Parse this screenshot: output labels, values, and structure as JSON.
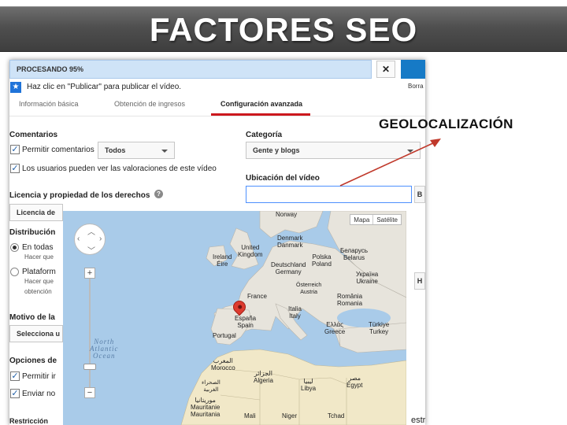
{
  "slide": {
    "title": "FACTORES SEO"
  },
  "annotation": {
    "label": "GEOLOCALIZACIÓN",
    "arrow_color": "#c0392b"
  },
  "upload": {
    "progress_label": "PROCESANDO 95%",
    "progress_value": 0.95,
    "close_label": "✕",
    "info_text": "Haz clic en \"Publicar\" para publicar el vídeo.",
    "info_icon": "star-icon",
    "draft_text": "Borra"
  },
  "tabs": [
    {
      "label": "Información básica",
      "active": false
    },
    {
      "label": "Obtención de ingresos",
      "active": false
    },
    {
      "label": "Configuración avanzada",
      "active": true
    }
  ],
  "left": {
    "comments_heading": "Comentarios",
    "allow_comments": "Permitir comentarios",
    "comments_select": "Todos",
    "ratings_label": "Los usuarios pueden ver las valoraciones de este vídeo",
    "license_heading": "Licencia y propiedad de los derechos",
    "license_select": "Licencia de",
    "distribution_heading": "Distribución",
    "dist_opt1": "En todas",
    "dist_opt1_sub": "Hacer que",
    "dist_opt2": "Plataform",
    "dist_opt2_sub1": "Hacer que",
    "dist_opt2_sub2": "obtención",
    "reason_heading": "Motivo de la",
    "reason_select": "Selecciona u",
    "options_heading": "Opciones de",
    "opt_allow": "Permitir ir",
    "opt_send": "Enviar no",
    "bottom_frag": "Restricción"
  },
  "right": {
    "category_heading": "Categoría",
    "category_select": "Gente y blogs",
    "location_heading": "Ubicación del vídeo",
    "location_value": "",
    "side_btn_b": "B",
    "side_btn_h": "H",
    "frag_right": "estr"
  },
  "map": {
    "type_map": "Mapa",
    "type_sat": "Satélite",
    "zoom_in": "+",
    "zoom_out": "−",
    "labels": {
      "norway": "Norway",
      "denmark": "Denmark\nDanmark",
      "uk": "United\nKingdom",
      "ireland": "Ireland\nÉire",
      "belarus": "Беларусь\nBelarus",
      "poland": "Polska\nPoland",
      "germany": "Deutschland\nGermany",
      "ukraine": "Україна\nUkraine",
      "austria": "Österreich\nAustria",
      "france": "France",
      "romania": "România\nRomania",
      "italy": "Italia\nItaly",
      "spain": "España\nSpain",
      "portugal": "Portugal",
      "greece": "Ελλάς\nGreece",
      "turkey": "Türkiye\nTurkey",
      "north_atlantic": "North\nAtlantic\nOcean",
      "morocco": "المغرب\nMorocco",
      "algeria": "الجزائر\nAlgeria",
      "libya": "ليبيا\nLibya",
      "egypt": "مصر\nEgypt",
      "western_sahara": "الصحراء\nالغربية",
      "mauritania": "موريتانيا\nMauritanie\nMauritania",
      "mali": "Mali",
      "niger": "Niger",
      "chad": "Tchad"
    }
  }
}
